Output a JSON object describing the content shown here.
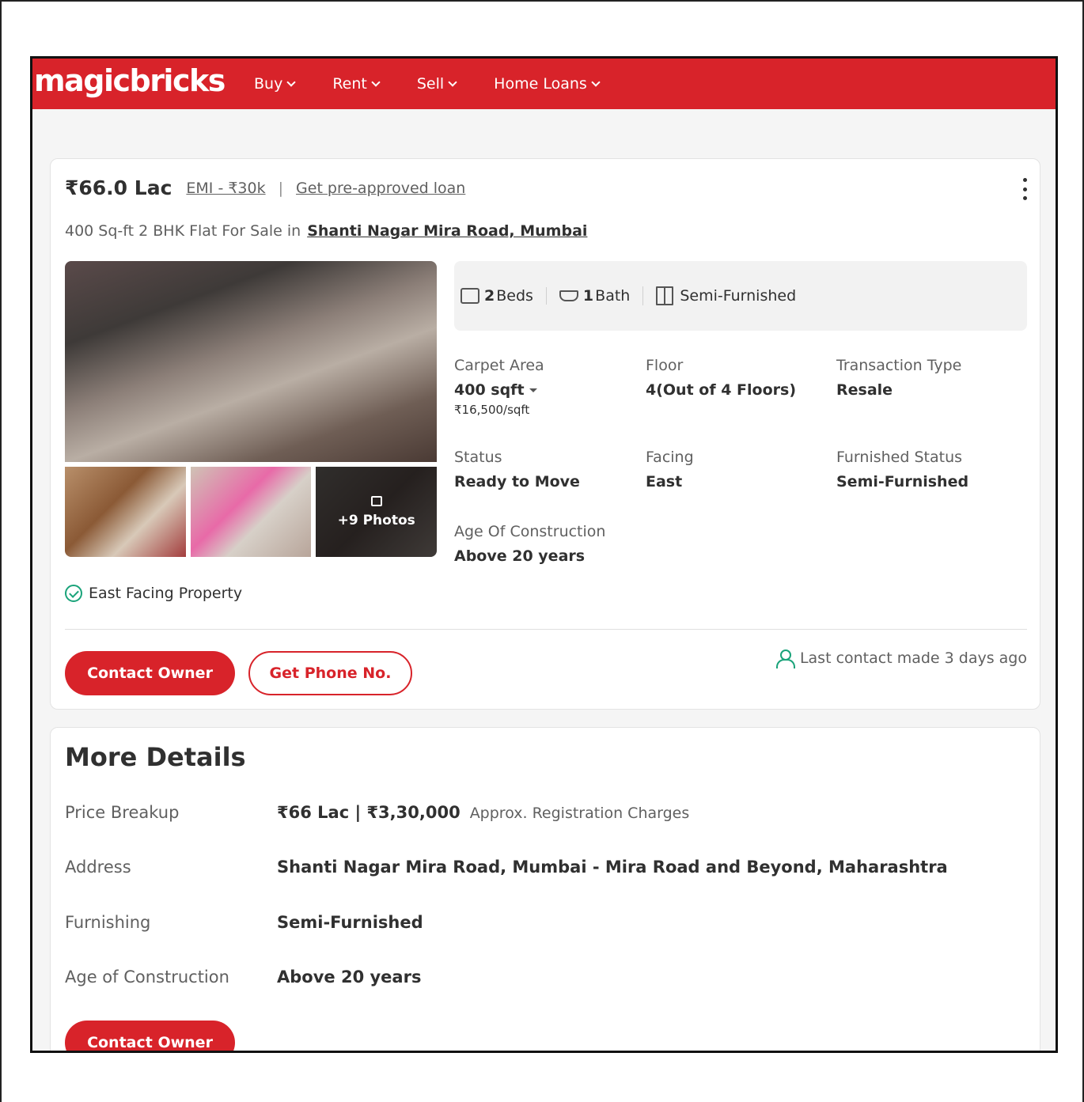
{
  "header": {
    "logo": "magicbricks",
    "nav": [
      {
        "label": "Buy"
      },
      {
        "label": "Rent"
      },
      {
        "label": "Sell"
      },
      {
        "label": "Home Loans"
      }
    ]
  },
  "listing": {
    "price": "₹66.0 Lac",
    "emi": "EMI - ₹30k",
    "separator": "|",
    "loan_link": "Get pre-approved loan",
    "subtitle": "400 Sq-ft 2 BHK Flat For Sale in",
    "location": "Shanti Nagar Mira Road, Mumbai",
    "more_photos": "+9 Photos",
    "features": [
      {
        "icon": "bed-icon",
        "count": "2",
        "label": "Beds"
      },
      {
        "icon": "bath-icon",
        "count": "1",
        "label": "Bath"
      },
      {
        "icon": "furniture-icon",
        "count": "",
        "label": "Semi-Furnished"
      }
    ],
    "details": {
      "carpet_area": {
        "label": "Carpet Area",
        "value": "400 sqft",
        "sub": "₹16,500/sqft"
      },
      "floor": {
        "label": "Floor",
        "value": "4(Out of 4 Floors)"
      },
      "transaction": {
        "label": "Transaction Type",
        "value": "Resale"
      },
      "status": {
        "label": "Status",
        "value": "Ready to Move"
      },
      "facing": {
        "label": "Facing",
        "value": "East"
      },
      "furnished": {
        "label": "Furnished Status",
        "value": "Semi-Furnished"
      },
      "age": {
        "label": "Age Of Construction",
        "value": "Above 20 years"
      }
    },
    "highlight": "East Facing Property",
    "contact_button": "Contact Owner",
    "phone_button": "Get Phone No.",
    "last_contact": "Last contact made 3 days ago"
  },
  "more_details": {
    "title": "More Details",
    "rows": [
      {
        "label": "Price Breakup",
        "value": "₹66 Lac | ₹3,30,000",
        "note": "Approx. Registration Charges"
      },
      {
        "label": "Address",
        "value": "Shanti Nagar Mira Road, Mumbai - Mira Road and Beyond, Maharashtra"
      },
      {
        "label": "Furnishing",
        "value": "Semi-Furnished"
      },
      {
        "label": "Age of Construction",
        "value": "Above 20 years"
      }
    ],
    "contact_button": "Contact Owner"
  },
  "colors": {
    "brand": "#d8232a",
    "accent_green": "#1aa37a"
  }
}
